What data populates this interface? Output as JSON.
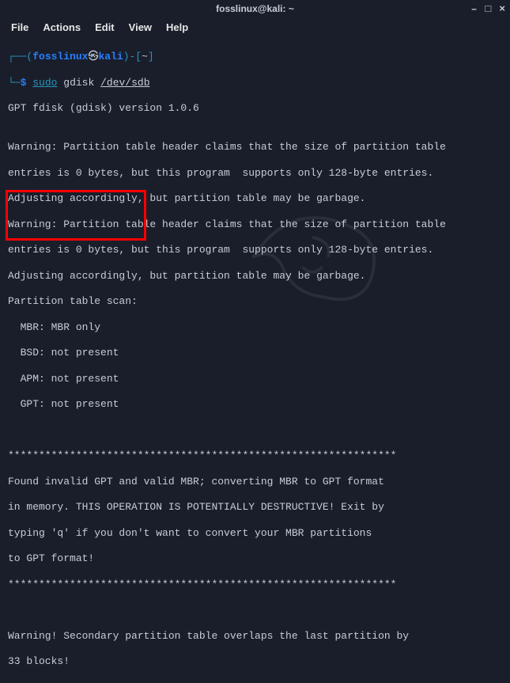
{
  "titlebar": {
    "title": "fosslinux@kali: ~"
  },
  "window_controls": {
    "minimize": "–",
    "maximize": "□",
    "close": "×"
  },
  "menubar": {
    "file": "File",
    "actions": "Actions",
    "edit": "Edit",
    "view": "View",
    "help": "Help"
  },
  "prompt": {
    "box_top_left": "┌──",
    "open_paren": "(",
    "user": "fosslinux",
    "at_symbol": "㉿",
    "host": "kali",
    "close_paren": ")",
    "dash": "-",
    "open_bracket": "[",
    "cwd": "~",
    "close_bracket": "]",
    "box_bottom": "└─",
    "prompt_char": "$",
    "sudo": "sudo",
    "cmd": "gdisk",
    "arg": "/dev/sdb"
  },
  "output": {
    "version": "GPT fdisk (gdisk) version 1.0.6",
    "blank": "",
    "warn1": "Warning: Partition table header claims that the size of partition table",
    "warn2": "entries is 0 bytes, but this program  supports only 128-byte entries.",
    "warn3": "Adjusting accordingly, but partition table may be garbage.",
    "warn4": "Warning: Partition table header claims that the size of partition table",
    "warn5": "entries is 0 bytes, but this program  supports only 128-byte entries.",
    "warn6": "Adjusting accordingly, but partition table may be garbage.",
    "scan_hdr": "Partition table scan:",
    "scan_mbr": "  MBR: MBR only",
    "scan_bsd": "  BSD: not present",
    "scan_apm": "  APM: not present",
    "scan_gpt": "  GPT: not present",
    "stars1": "***************************************************************",
    "found1": "Found invalid GPT and valid MBR; converting MBR to GPT format",
    "found2": "in memory. THIS OPERATION IS POTENTIALLY DESTRUCTIVE! Exit by",
    "found3": "typing 'q' if you don't want to convert your MBR partitions",
    "found4": "to GPT format!",
    "stars2": "***************************************************************",
    "warn7": "Warning! Secondary partition table overlaps the last partition by",
    "warn8": "33 blocks!"
  }
}
